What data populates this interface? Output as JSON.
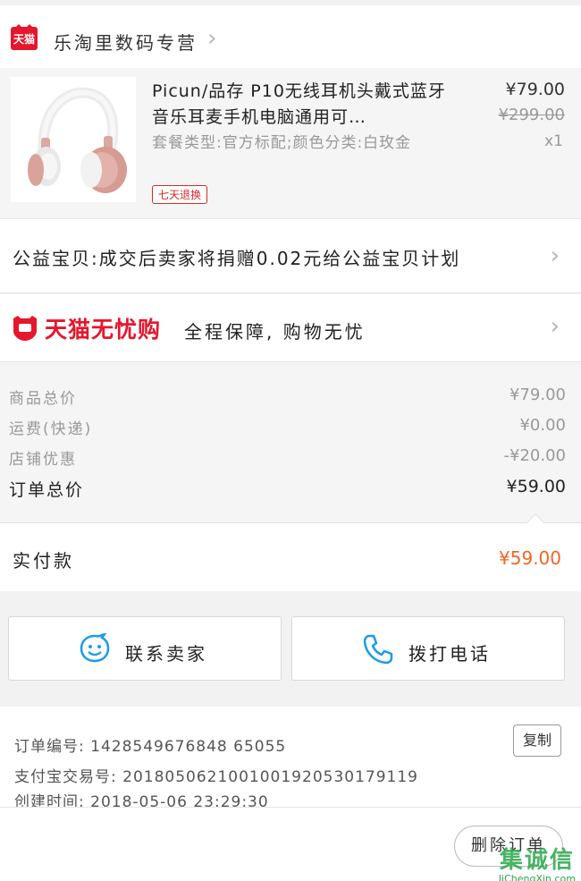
{
  "store": {
    "logo_text": "天猫",
    "name": "乐淘里数码专营"
  },
  "product": {
    "title": "Picun/品存 P10无线耳机头戴式蓝牙音乐耳麦手机电脑通用可…",
    "spec": "套餐类型:官方标配;颜色分类:白玫金",
    "badge": "七天退换",
    "price": "¥79.00",
    "original_price": "¥299.00",
    "quantity": "x1"
  },
  "charity": {
    "text": "公益宝贝:成交后卖家将捐赠0.02元给公益宝贝计划"
  },
  "worry_free": {
    "brand": "天猫无忧购",
    "text": "全程保障, 购物无忧"
  },
  "summary": {
    "rows": [
      {
        "label": "商品总价",
        "value": "¥79.00"
      },
      {
        "label": "运费(快递)",
        "value": "¥0.00"
      },
      {
        "label": "店铺优惠",
        "value": "-¥20.00"
      }
    ],
    "total_label": "订单总价",
    "total_value": "¥59.00"
  },
  "paid": {
    "label": "实付款",
    "value": "¥59.00"
  },
  "actions": {
    "contact_label": "联系卖家",
    "call_label": "拨打电话"
  },
  "info": {
    "order_no": "订单编号: 1428549676848 65055",
    "alipay_no": "支付宝交易号: 2018050621001001920530179119",
    "created": "创建时间: 2018-05-06 23:29:30",
    "copy_label": "复制"
  },
  "bottom": {
    "delete_label": "删除订单",
    "watermark_main": "集诚信",
    "watermark_sub": "JiChengXin.com"
  },
  "colors": {
    "brand_red": "#e6162d",
    "price_orange": "#f26522",
    "icon_blue": "#1a9be8"
  }
}
